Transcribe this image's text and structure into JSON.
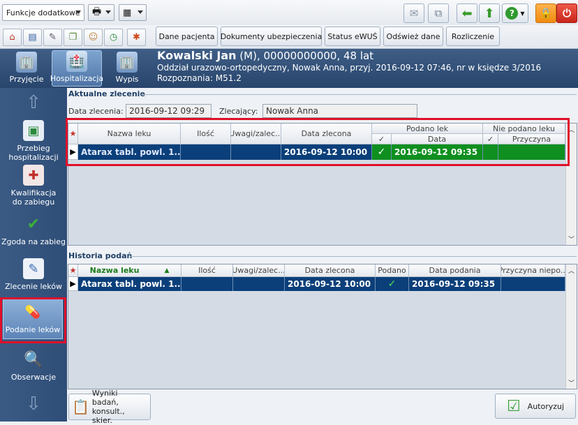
{
  "toolbar": {
    "functions_dropdown": "Funkcje dodatkowe"
  },
  "actions": {
    "patient_data": "Dane pacjenta",
    "insurance_docs": "Dokumenty ubezpieczenia",
    "ewus_status": "Status eWUŚ",
    "refresh": "Odśwież dane",
    "settlement": "Rozliczenie"
  },
  "modes": {
    "admission": "Przyjęcie",
    "hospitalization": "Hospitalizacja",
    "discharge": "Wypis"
  },
  "patient": {
    "name": "Kowalski Jan",
    "details": " (M), 00000000000, 48 lat",
    "ward_line": "Oddział urazowo-ortopedyczny, Nowak Anna, przyj. 2016-09-12 07:46, nr w księdze 3/2016",
    "diagnosis_line": "Rozpoznania: M51.2"
  },
  "nav": {
    "course": "Przebieg hospitalizacji",
    "qualification": "Kwalifikacja do zabiegu",
    "consent": "Zgoda na zabieg",
    "drug_order": "Zlecenie leków",
    "drug_admin": "Podanie leków",
    "observations": "Obserwacje"
  },
  "current_order": {
    "section_title": "Aktualne zlecenie",
    "date_label": "Data zlecenia:",
    "date_value": "2016-09-12 09:29",
    "orderer_label": "Zlecający:",
    "orderer_value": "Nowak Anna",
    "columns": {
      "drug_name": "Nazwa leku",
      "quantity": "Ilość",
      "notes": "Uwagi/zalec...",
      "order_date": "Data zlecona",
      "given_group": "Podano lek",
      "given_check": "✓",
      "given_date": "Data",
      "not_given_group": "Nie podano leku",
      "not_given_check": "✓",
      "reason": "Przyczyna"
    },
    "rows": [
      {
        "drug_name": "Atarax tabl. powl. 1...",
        "quantity": "",
        "notes": "",
        "order_date": "2016-09-12 10:00",
        "given": "✓",
        "given_date": "2016-09-12 09:35",
        "not_given": "",
        "reason": ""
      }
    ]
  },
  "history": {
    "section_title": "Historia podań",
    "columns": {
      "drug_name": "Nazwa leku",
      "quantity": "Ilość",
      "notes": "Uwagi/zalec...",
      "order_date": "Data zlecona",
      "given": "Podano",
      "given_date": "Data podania",
      "reason": "Przyczyna niepo..."
    },
    "rows": [
      {
        "drug_name": "Atarax tabl. powl. 1...",
        "quantity": "",
        "notes": "",
        "order_date": "2016-09-12 10:00",
        "given": "✓",
        "given_date": "2016-09-12 09:35",
        "reason": ""
      }
    ]
  },
  "bottom": {
    "results_button": "Wyniki badań, konsult., skier.",
    "authorize_button": "Autoryzuj"
  },
  "colors": {
    "header_blue": "#2f4f78",
    "row_selected": "#0b3f7a",
    "row_given_green": "#0f8f1f",
    "highlight_red": "#e0102a"
  }
}
